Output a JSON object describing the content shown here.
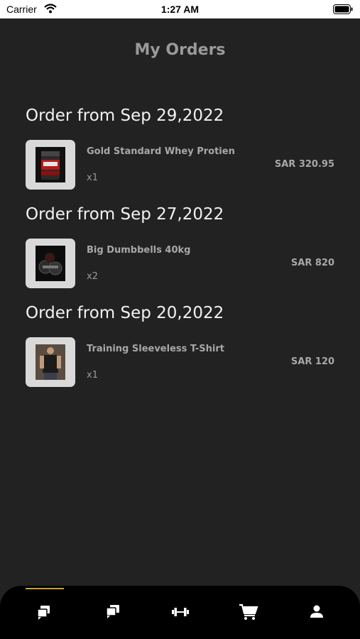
{
  "status_bar": {
    "carrier": "Carrier",
    "time": "1:27 AM"
  },
  "page": {
    "title": "My Orders"
  },
  "orders": [
    {
      "heading": "Order from Sep 29,2022",
      "item": {
        "name": "Gold Standard Whey Protien",
        "qty": "x1",
        "price": "SAR 320.95",
        "image": "whey-protein-tub"
      }
    },
    {
      "heading": "Order from Sep 27,2022",
      "item": {
        "name": "Big Dumbbells 40kg",
        "qty": "x2",
        "price": "SAR 820",
        "image": "dumbbells"
      }
    },
    {
      "heading": "Order from Sep 20,2022",
      "item": {
        "name": "Training Sleeveless T-Shirt",
        "qty": "x1",
        "price": "SAR 120",
        "image": "sleeveless-shirt"
      }
    }
  ],
  "tab_bar": {
    "active_index": 0,
    "accent_color": "#c9a227",
    "tabs": [
      "orders-icon",
      "chat-icon",
      "dumbbell-icon",
      "cart-icon",
      "profile-icon"
    ]
  },
  "colors": {
    "background": "#222222",
    "tab_bar": "#000000",
    "accent": "#c9a227"
  }
}
